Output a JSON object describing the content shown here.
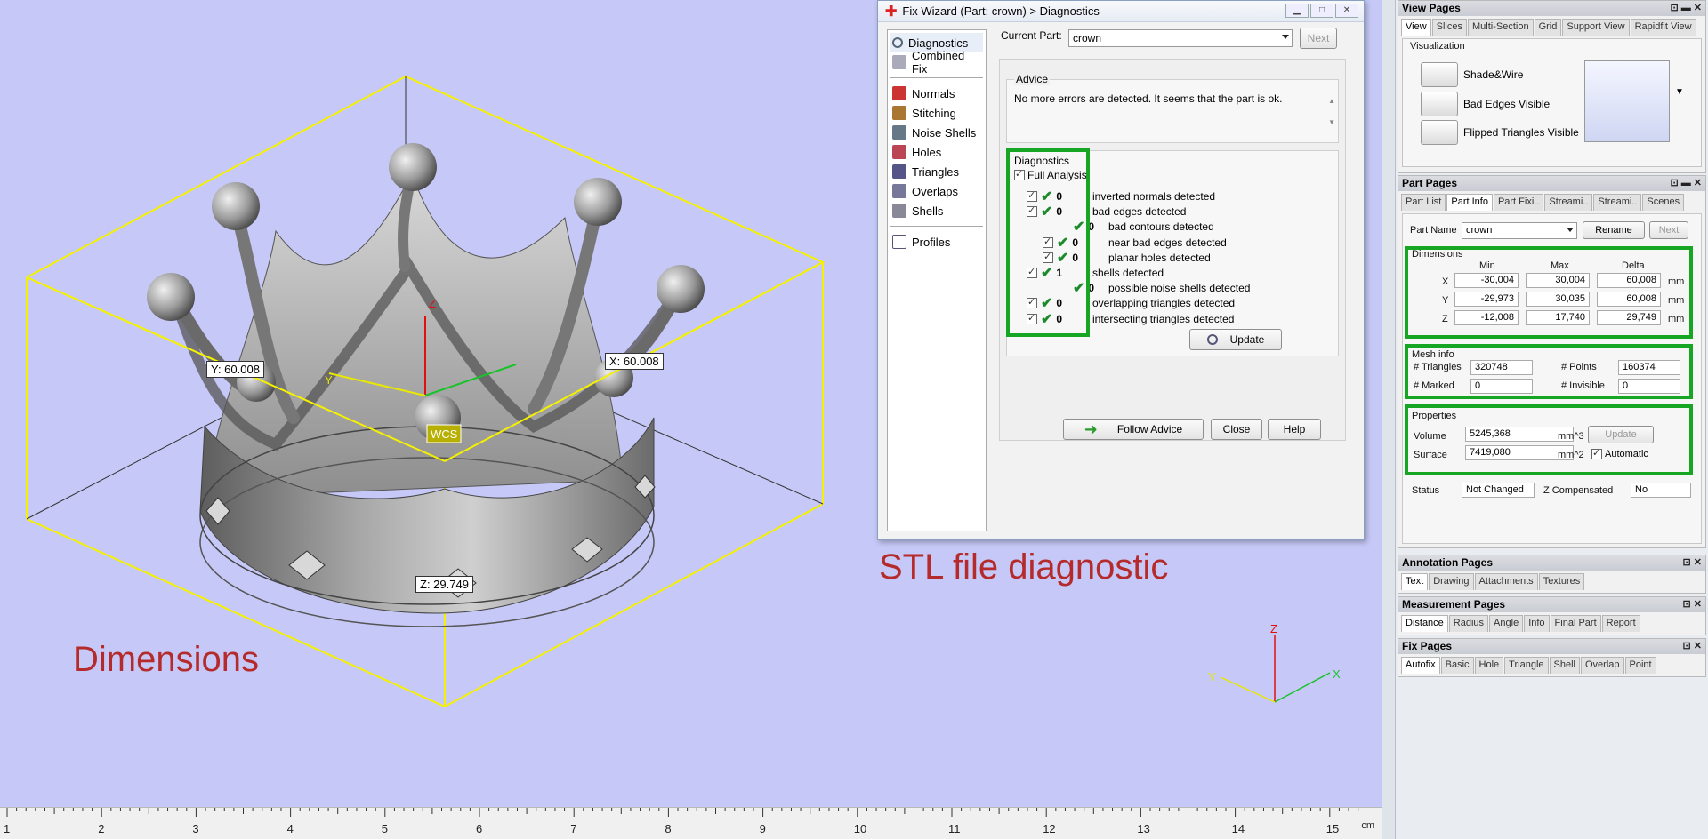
{
  "viewport": {
    "labels": {
      "y_dim": "Y: 60.008",
      "x_dim": "X: 60.008",
      "z_dim": "Z: 29.749",
      "wcs": "WCS",
      "axis_z": "Z"
    },
    "captions": {
      "dimensions": "Dimensions",
      "stl": "STL file diagnostic"
    },
    "mini_axes": {
      "z": "Z",
      "x": "X",
      "y": "Y"
    },
    "ruler": {
      "ticks": [
        "1",
        "2",
        "3",
        "4",
        "5",
        "6",
        "7",
        "8",
        "9",
        "10",
        "11",
        "12",
        "13",
        "14",
        "15"
      ],
      "unit": "cm"
    }
  },
  "wizard": {
    "title": "Fix Wizard (Part: crown) > Diagnostics",
    "nav": {
      "diagnostics": "Diagnostics",
      "combined_fix": "Combined Fix",
      "normals": "Normals",
      "stitching": "Stitching",
      "noise_shells": "Noise Shells",
      "holes": "Holes",
      "triangles": "Triangles",
      "overlaps": "Overlaps",
      "shells": "Shells",
      "profiles": "Profiles"
    },
    "current_part_label": "Current Part:",
    "current_part_value": "crown",
    "next_label": "Next",
    "advice_title": "Advice",
    "advice_text": "No more errors are detected. It seems that the part is ok.",
    "diagnostics_title": "Diagnostics",
    "full_analysis": "Full Analysis",
    "rows": [
      {
        "count": "0",
        "text": "inverted normals detected"
      },
      {
        "count": "0",
        "text": "bad edges detected"
      },
      {
        "count": "0",
        "text": "bad contours detected"
      },
      {
        "count": "0",
        "text": "near bad edges detected"
      },
      {
        "count": "0",
        "text": "planar holes detected"
      },
      {
        "count": "1",
        "text": "shells detected"
      },
      {
        "count": "0",
        "text": "possible noise shells detected"
      },
      {
        "count": "0",
        "text": "overlapping triangles detected"
      },
      {
        "count": "0",
        "text": "intersecting triangles detected"
      }
    ],
    "update_label": "Update",
    "follow_advice_label": "Follow Advice",
    "close_label": "Close",
    "help_label": "Help"
  },
  "right": {
    "view_pages": {
      "title": "View Pages",
      "tabs": [
        "View",
        "Slices",
        "Multi-Section",
        "Grid",
        "Support View",
        "Rapidfit View"
      ],
      "visualization": "Visualization",
      "shade_wire": "Shade&Wire",
      "bad_edges": "Bad Edges Visible",
      "flipped": "Flipped Triangles Visible"
    },
    "part_pages": {
      "title": "Part Pages",
      "tabs": [
        "Part List",
        "Part Info",
        "Part Fixi..",
        "Streami..",
        "Streami..",
        "Scenes"
      ],
      "part_name_label": "Part Name",
      "part_name_value": "crown",
      "rename": "Rename",
      "next": "Next",
      "dimensions_title": "Dimensions",
      "col_min": "Min",
      "col_max": "Max",
      "col_delta": "Delta",
      "rows": [
        {
          "axis": "X",
          "min": "-30,004",
          "max": "30,004",
          "delta": "60,008",
          "unit": "mm"
        },
        {
          "axis": "Y",
          "min": "-29,973",
          "max": "30,035",
          "delta": "60,008",
          "unit": "mm"
        },
        {
          "axis": "Z",
          "min": "-12,008",
          "max": "17,740",
          "delta": "29,749",
          "unit": "mm"
        }
      ],
      "mesh_title": "Mesh info",
      "triangles_label": "# Triangles",
      "triangles_value": "320748",
      "points_label": "# Points",
      "points_value": "160374",
      "marked_label": "# Marked",
      "marked_value": "0",
      "invisible_label": "# Invisible",
      "invisible_value": "0",
      "properties_title": "Properties",
      "volume_label": "Volume",
      "volume_value": "5245,368",
      "volume_unit": "mm^3",
      "surface_label": "Surface",
      "surface_value": "7419,080",
      "surface_unit": "mm^2",
      "update": "Update",
      "automatic": "Automatic",
      "status_label": "Status",
      "status_value": "Not Changed",
      "zcomp_label": "Z Compensated",
      "zcomp_value": "No"
    },
    "annotation_pages": {
      "title": "Annotation Pages",
      "tabs": [
        "Text",
        "Drawing",
        "Attachments",
        "Textures"
      ]
    },
    "measurement_pages": {
      "title": "Measurement Pages",
      "tabs": [
        "Distance",
        "Radius",
        "Angle",
        "Info",
        "Final Part",
        "Report"
      ]
    },
    "fix_pages": {
      "title": "Fix Pages",
      "tabs": [
        "Autofix",
        "Basic",
        "Hole",
        "Triangle",
        "Shell",
        "Overlap",
        "Point"
      ]
    }
  },
  "colors": {
    "highlight": "#17a524",
    "caption": "#b52a2a",
    "viewport_bg": "#c6c8f7",
    "bbox": "#f5f100"
  }
}
